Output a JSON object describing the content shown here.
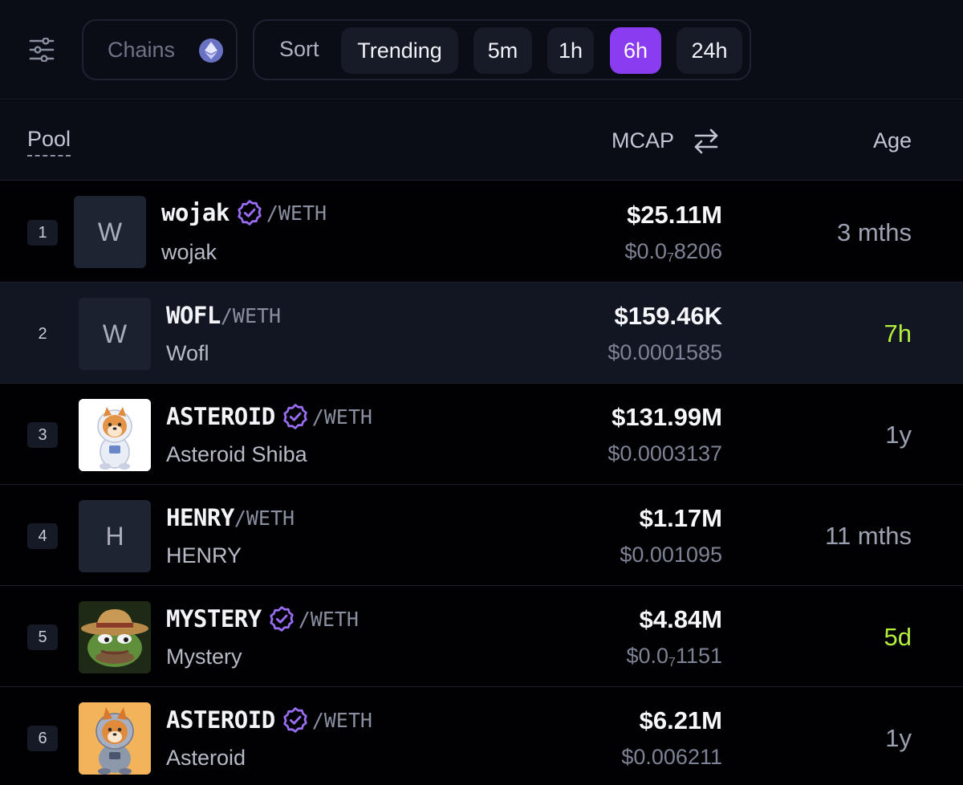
{
  "toolbar": {
    "filter_icon": "sliders-icon",
    "chains_label": "Chains",
    "chain_icon": "ethereum-icon",
    "sort_label": "Sort",
    "sort_options": [
      {
        "label": "Trending",
        "active": false
      },
      {
        "label": "5m",
        "active": false
      },
      {
        "label": "1h",
        "active": false
      },
      {
        "label": "6h",
        "active": true
      },
      {
        "label": "24h",
        "active": false
      }
    ]
  },
  "header": {
    "pool": "Pool",
    "mcap": "MCAP",
    "swap_icon": "swap-arrows-icon",
    "age": "Age"
  },
  "colors": {
    "accent": "#8a3cf0",
    "verified": "#9b6ef5",
    "fresh_age": "#b4ee3f"
  },
  "pools": [
    {
      "rank": "1",
      "symbol": "wojak",
      "quote": "/WETH",
      "name": "wojak",
      "verified": true,
      "avatar": "W",
      "mcap": "$25.11M",
      "price_prefix": "$0.0",
      "price_sub": "7",
      "price_rest": "8206",
      "age": "3 mths",
      "fresh": false
    },
    {
      "rank": "2",
      "symbol": "WOFL",
      "quote": "/WETH",
      "name": "Wofl",
      "verified": false,
      "avatar": "W",
      "mcap": "$159.46K",
      "price_prefix": "$0.0001585",
      "price_sub": "",
      "price_rest": "",
      "age": "7h",
      "fresh": true
    },
    {
      "rank": "3",
      "symbol": "ASTEROID",
      "quote": "/WETH",
      "name": "Asteroid Shiba",
      "verified": true,
      "avatar": "",
      "mcap": "$131.99M",
      "price_prefix": "$0.0003137",
      "price_sub": "",
      "price_rest": "",
      "age": "1y",
      "fresh": false
    },
    {
      "rank": "4",
      "symbol": "HENRY",
      "quote": "/WETH",
      "name": "HENRY",
      "verified": false,
      "avatar": "H",
      "mcap": "$1.17M",
      "price_prefix": "$0.001095",
      "price_sub": "",
      "price_rest": "",
      "age": "11 mths",
      "fresh": false
    },
    {
      "rank": "5",
      "symbol": "MYSTERY",
      "quote": "/WETH",
      "name": "Mystery",
      "verified": true,
      "avatar": "",
      "mcap": "$4.84M",
      "price_prefix": "$0.0",
      "price_sub": "7",
      "price_rest": "1151",
      "age": "5d",
      "fresh": true
    },
    {
      "rank": "6",
      "symbol": "ASTEROID",
      "quote": "/WETH",
      "name": "Asteroid",
      "verified": true,
      "avatar": "",
      "mcap": "$6.21M",
      "price_prefix": "$0.006211",
      "price_sub": "",
      "price_rest": "",
      "age": "1y",
      "fresh": false
    }
  ]
}
